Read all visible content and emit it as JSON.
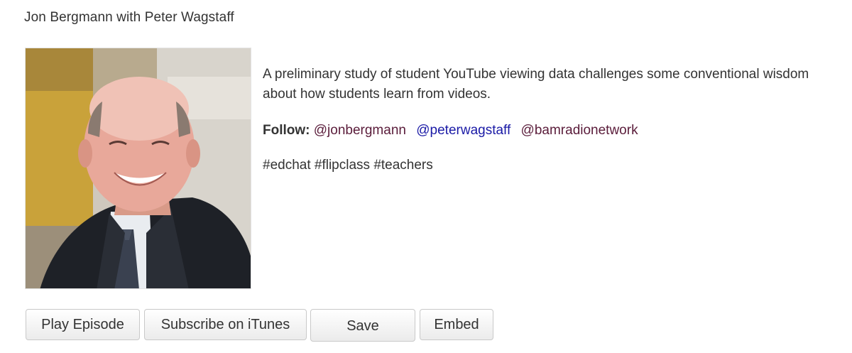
{
  "episode": {
    "title": "Jon Bergmann with Peter Wagstaff",
    "description": "A preliminary study of student YouTube viewing data challenges some conventional wisdom about how students learn from videos.",
    "follow_label": "Follow:",
    "handles": [
      "@jonbergmann",
      "@peterwagstaff",
      "@bamradionetwork"
    ],
    "hashtags": "#edchat #flipclass #teachers"
  },
  "buttons": {
    "play": "Play Episode",
    "itunes": "Subscribe on iTunes",
    "save": "Save",
    "embed": "Embed"
  },
  "colors": {
    "text": "#333333",
    "handle_maroon": "#5a1c3a",
    "handle_blue": "#1a1aa6"
  }
}
